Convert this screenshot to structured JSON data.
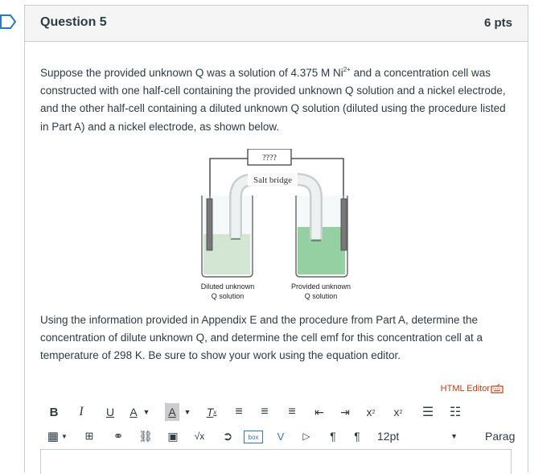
{
  "question": {
    "title": "Question 5",
    "points": "6 pts",
    "para1_part1": "Suppose the provided unknown Q was a solution of 4.375 M Ni",
    "para1_sup": "2+",
    "para1_part2": " and a concentration cell was constructed with one half-cell containing the provided unknown Q solution and a nickel electrode, and the other half-cell containing a diluted unknown Q solution (diluted using the procedure listed in Part A) and a nickel electrode, as shown below.",
    "para2": "Using the information provided in Appendix E and the procedure from Part A, determine the concentration of dilute unknown Q, and determine the cell emf for this concentration cell at a temperature of 298 K. Be sure to show your work using the equation editor."
  },
  "figure": {
    "meter_label": "????",
    "bridge_label": "Salt bridge",
    "left_label_1": "Diluted unknown",
    "left_label_2": "Q solution",
    "right_label_1": "Provided unknown",
    "right_label_2": "Q solution",
    "left_solution_color": "#cfe6cc",
    "right_solution_color": "#7ec98c"
  },
  "editor": {
    "html_editor_label": "HTML Editor",
    "font_size": "12pt",
    "paragraph": "Parag",
    "accent_color": "#c23c0d",
    "toolbar1": [
      "bold-icon",
      "italic-icon",
      "underline-icon",
      "text-color-icon",
      "background-color-icon",
      "clear-formatting-icon",
      "align-left-icon",
      "align-center-icon",
      "align-right-icon",
      "outdent-icon",
      "indent-icon",
      "superscript-icon",
      "subscript-icon",
      "bullet-list-icon",
      "numbered-list-icon"
    ],
    "toolbar2": [
      "table-icon",
      "media-icon",
      "link-icon",
      "unlink-icon",
      "image-icon",
      "equation-icon",
      "external-tool-icon",
      "box-icon",
      "vimeo-icon",
      "video-icon",
      "ltr-icon",
      "rtl-icon"
    ]
  }
}
